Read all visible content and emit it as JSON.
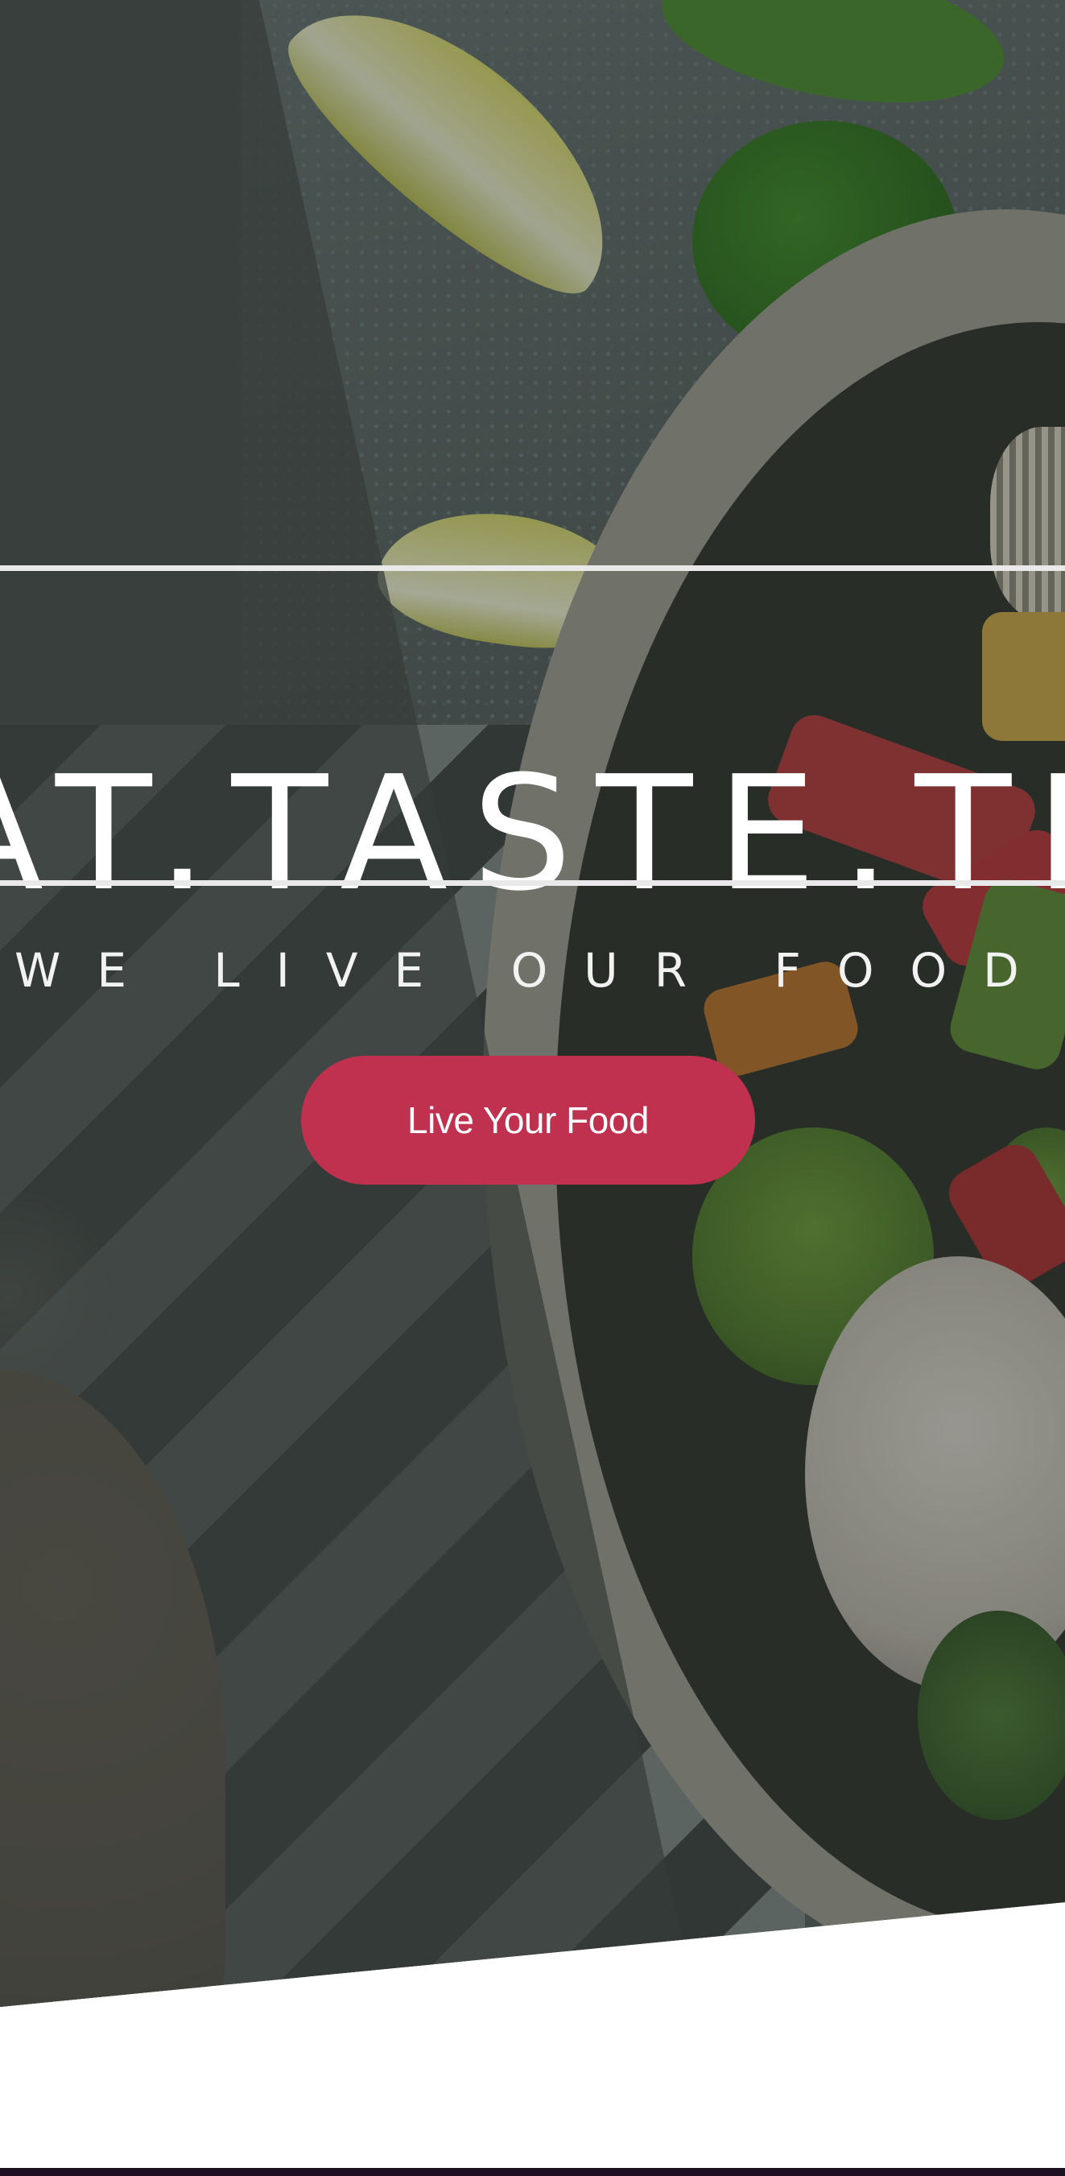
{
  "hero": {
    "headline": "AT.TASTE.TRY",
    "tagline": "WE LIVE OUR FOOD",
    "cta_label": "Live Your Food"
  },
  "colors": {
    "accent": "#c0304f",
    "text": "#ffffff",
    "rule": "#e9e9e9",
    "panel": "#3a403d",
    "bottom_strip": "#1e0f22"
  }
}
